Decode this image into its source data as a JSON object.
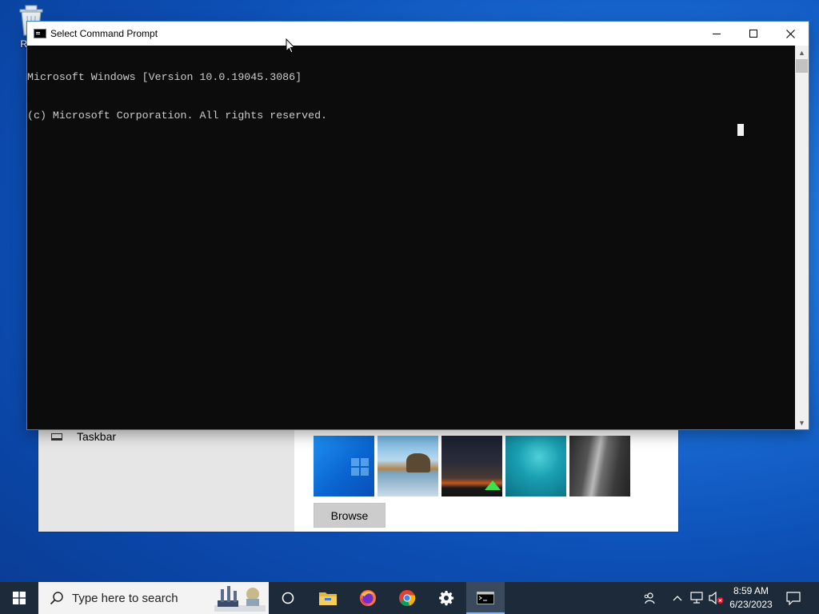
{
  "desktop": {
    "recycle_bin_label": "Recy"
  },
  "cmd_window": {
    "title": "Select Command Prompt",
    "lines": [
      "Microsoft Windows [Version 10.0.19045.3086]",
      "(c) Microsoft Corporation. All rights reserved."
    ],
    "background_color": "#0c0c0c",
    "text_color": "#cccccc"
  },
  "settings_window": {
    "sidebar_item_label": "Taskbar",
    "browse_label": "Browse",
    "picture_thumbnails": [
      "windows-blue-wallpaper",
      "beach-rocks-wallpaper",
      "night-sky-tent-wallpaper",
      "underwater-swimmer-wallpaper",
      "waterfall-cliff-wallpaper"
    ]
  },
  "taskbar": {
    "search_placeholder": "Type here to search",
    "pinned_apps": [
      "cortana-icon",
      "file-explorer-icon",
      "firefox-icon",
      "chrome-icon",
      "settings-icon",
      "command-prompt-icon"
    ],
    "clock_time": "8:59 AM",
    "clock_date": "6/23/2023",
    "background_color": "#1c2a3a"
  }
}
